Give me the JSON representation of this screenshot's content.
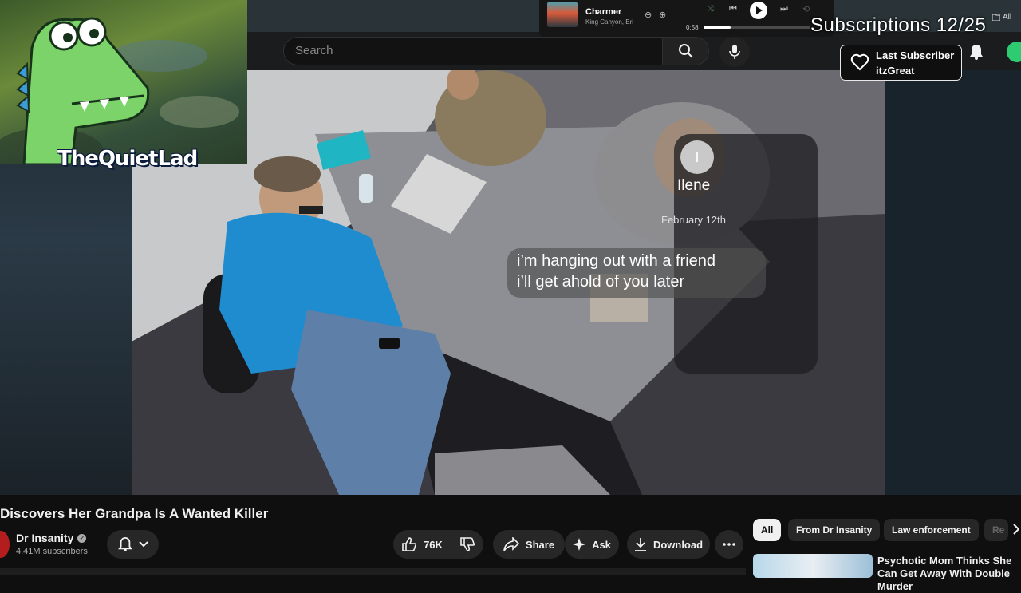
{
  "header": {
    "search_placeholder": "Search",
    "all_label": "All"
  },
  "music_player": {
    "song": "Charmer",
    "artist": "King Canyon, Eri",
    "elapsed": "0:58",
    "progress_fraction": 0.25
  },
  "stream_overlay": {
    "subscriptions_goal": "Subscriptions 12/25",
    "last_subscriber_title": "Last Subscriber",
    "last_subscriber_name": "itzGreat",
    "webcam_label": "TheQuietLad"
  },
  "video_overlay": {
    "contact_initial": "I",
    "contact_name": "Ilene",
    "date": "February 12th",
    "message_line1": "i’m hanging out with a friend",
    "message_line2": "i’ll get ahold of you later"
  },
  "video": {
    "title": "Discovers Her Grandpa Is A Wanted Killer",
    "channel_name": "Dr Insanity",
    "channel_subscribers": "4.41M subscribers",
    "like_count": "76K",
    "share_label": "Share",
    "ask_label": "Ask",
    "download_label": "Download"
  },
  "sidebar": {
    "chips": [
      "All",
      "From Dr Insanity",
      "Law enforcement",
      "Re"
    ],
    "recommendation_title": "Psychotic Mom Thinks She Can Get Away With Double Murder"
  },
  "colors": {
    "background": "#0f0f0f",
    "pill": "#272727",
    "accent_green": "#2ecc71"
  }
}
